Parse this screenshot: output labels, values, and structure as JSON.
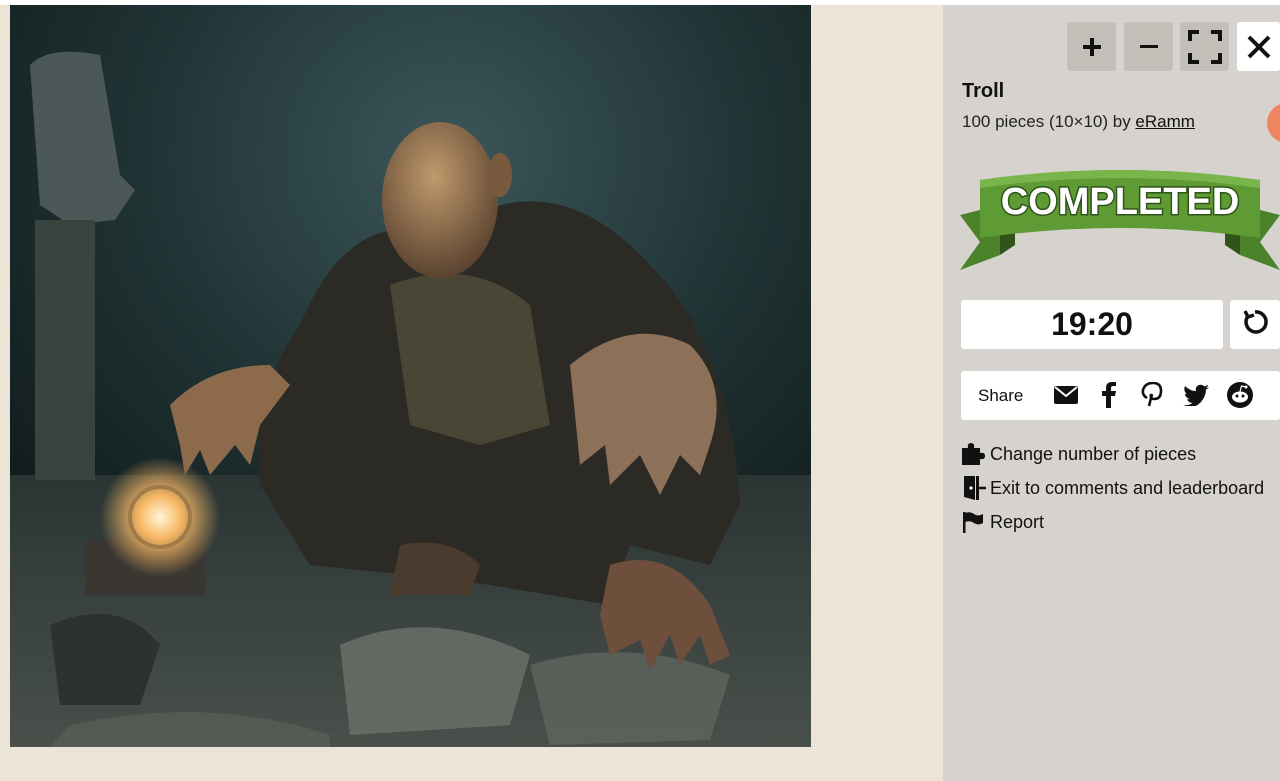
{
  "puzzle": {
    "title": "Troll",
    "meta_prefix": "100 pieces (10×10) by ",
    "author": "eRamm",
    "image_alt": "Troll"
  },
  "toolbar": {
    "zoom_in_icon": "plus-icon",
    "zoom_out_icon": "minus-icon",
    "fullscreen_icon": "fullscreen-icon",
    "close_icon": "close-icon"
  },
  "status": {
    "banner_text": "COMPLETED",
    "timer": "19:20"
  },
  "share": {
    "label": "Share",
    "icons": [
      "email-icon",
      "facebook-icon",
      "pinterest-icon",
      "twitter-icon",
      "reddit-icon"
    ]
  },
  "actions": {
    "change_pieces": "Change number of pieces",
    "exit": "Exit to comments and leaderboard",
    "report": "Report"
  },
  "colors": {
    "stage_bg": "#ebe4d7",
    "sidebar_bg": "#d6d3ce",
    "tool_button_bg": "#c2beb8",
    "banner_green": "#5f9b35",
    "banner_dark_green": "#3e6f22",
    "avatar": "#f08461"
  }
}
